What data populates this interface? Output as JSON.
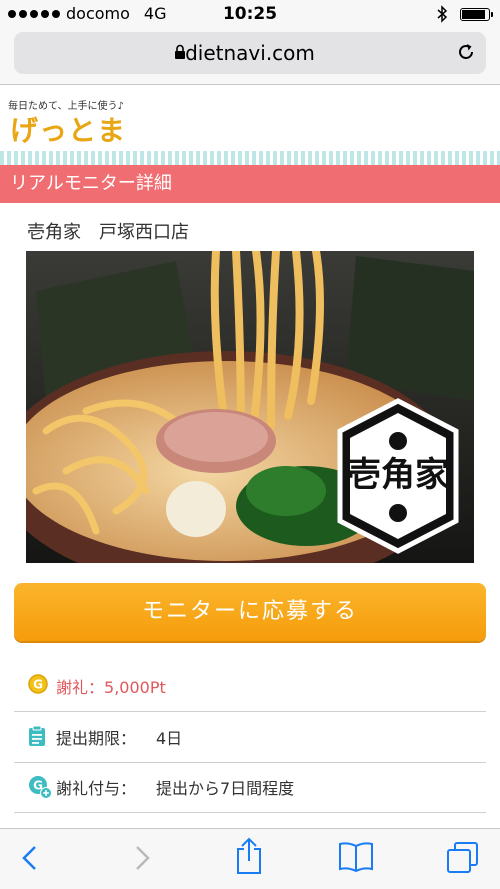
{
  "status": {
    "carrier": "docomo",
    "network": "4G",
    "time": "10:25",
    "battery_level": 0.9
  },
  "browser": {
    "url": "dietnavi.com"
  },
  "site": {
    "tagline": "毎日ためて、上手に使う♪",
    "logo": "げっとま"
  },
  "section": {
    "title": "リアルモニター詳細"
  },
  "shop": {
    "name": "壱角家　戸塚西口店",
    "photo_logo": "壱角家"
  },
  "cta": {
    "label": "モニターに応募する"
  },
  "info": {
    "reward": {
      "label": "謝礼：",
      "value": "5,000Pt",
      "icon": "coin-g-icon"
    },
    "deadline": {
      "label": "提出期限：",
      "value": "4日",
      "icon": "clipboard-icon"
    },
    "grant": {
      "label": "謝礼付与：",
      "value": "提出から7日間程度",
      "icon": "coin-plus-icon"
    }
  },
  "colors": {
    "accent": "#f06e72",
    "cta": "#f9a81c",
    "ios_blue": "#1a7cf5",
    "logo": "#e8a615"
  }
}
